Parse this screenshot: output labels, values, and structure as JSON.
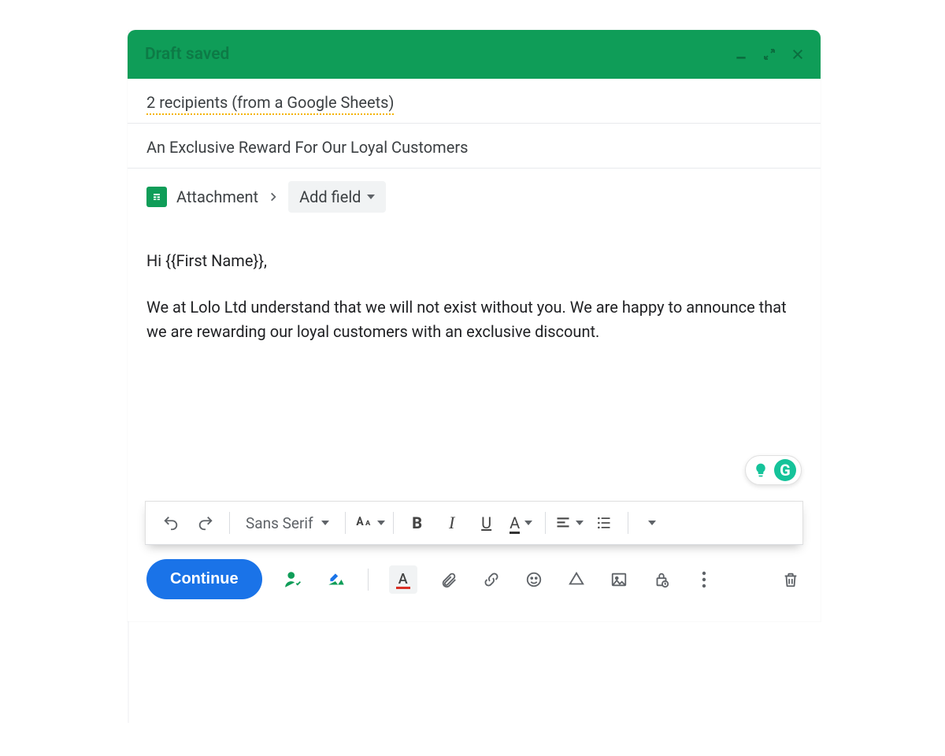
{
  "header": {
    "title": "Draft saved"
  },
  "recipients": {
    "summary": "2 recipients (from a Google Sheets)"
  },
  "subject": "An Exclusive Reward For Our Loyal Customers",
  "attachment": {
    "label": "Attachment",
    "add_field_label": "Add field"
  },
  "body": {
    "greeting": "Hi {{First Name}},",
    "paragraph1": "We at Lolo Ltd understand that we will not exist without you. We are happy to announce that we are rewarding our loyal customers with an exclusive discount."
  },
  "grammarly": {
    "letter": "G"
  },
  "format_toolbar": {
    "font_name": "Sans Serif"
  },
  "actions": {
    "continue_label": "Continue"
  },
  "colors": {
    "brand_green": "#0f9d58",
    "blue": "#1a73e8",
    "grammarly_green": "#15c39a",
    "warning_underline": "#f4b400",
    "error_red": "#d93025"
  }
}
